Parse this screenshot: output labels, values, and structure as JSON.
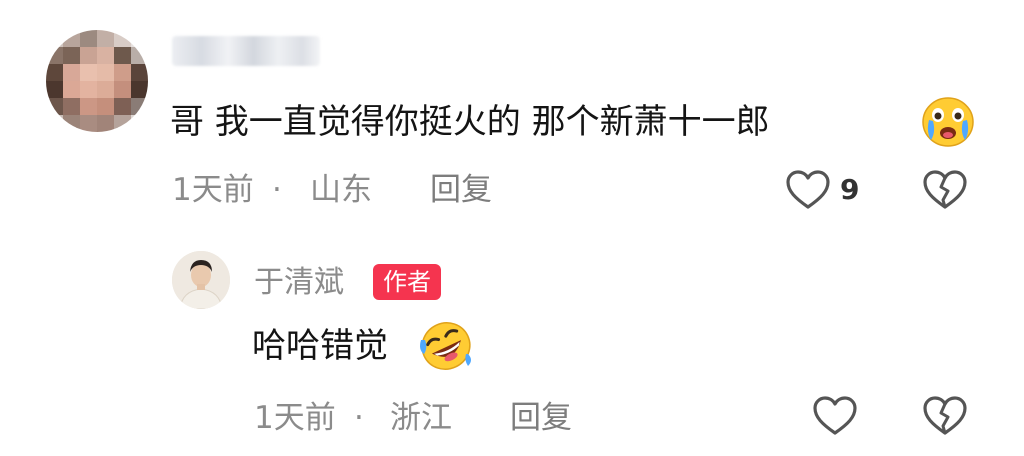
{
  "comment": {
    "text": "哥 我一直觉得你挺火的 那个新萧十一郎",
    "emoji": "crying-face",
    "time": "1天前",
    "separator": "·",
    "location": "山东",
    "reply_label": "回复",
    "like_count": "9"
  },
  "reply": {
    "username": "于清斌",
    "badge": "作者",
    "text": "哈哈错觉",
    "emoji": "rolling-laughing-face",
    "time": "1天前",
    "separator": "·",
    "location": "浙江",
    "reply_label": "回复"
  },
  "colors": {
    "badge_bg": "#f5344f",
    "icon_stroke": "#555555",
    "meta_text": "#8b8b8b",
    "main_text": "#141414"
  }
}
